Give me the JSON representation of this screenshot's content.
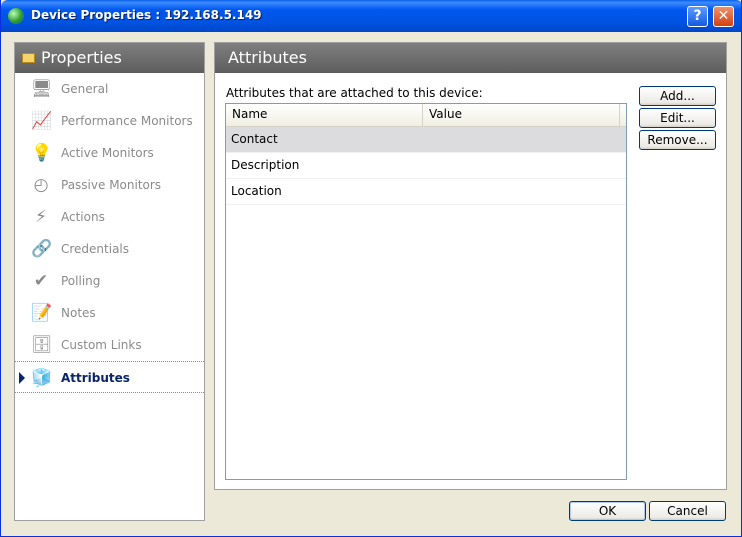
{
  "window": {
    "title": "Device Properties : 192.168.5.149",
    "help_glyph": "?",
    "close_glyph": "✕"
  },
  "sidebar": {
    "title": "Properties",
    "items": [
      {
        "label": "General",
        "icon": "computer-icon",
        "glyph": "🖥"
      },
      {
        "label": "Performance Monitors",
        "icon": "performance-chart-icon",
        "glyph": "📈"
      },
      {
        "label": "Active Monitors",
        "icon": "lightbulb-icon",
        "glyph": "💡"
      },
      {
        "label": "Passive Monitors",
        "icon": "gauge-icon",
        "glyph": "◴"
      },
      {
        "label": "Actions",
        "icon": "lightning-icon",
        "glyph": "⚡"
      },
      {
        "label": "Credentials",
        "icon": "network-credentials-icon",
        "glyph": "🔗"
      },
      {
        "label": "Polling",
        "icon": "checkmark-icon",
        "glyph": "✔"
      },
      {
        "label": "Notes",
        "icon": "notepad-icon",
        "glyph": "📝"
      },
      {
        "label": "Custom Links",
        "icon": "custom-links-icon",
        "glyph": "🗄"
      },
      {
        "label": "Attributes",
        "icon": "blocks-icon",
        "glyph": "🧊"
      }
    ],
    "active_index": 9
  },
  "main": {
    "title": "Attributes",
    "description": "Attributes that are attached to this device:",
    "columns": [
      "Name",
      "Value"
    ],
    "rows": [
      {
        "name": "Contact",
        "value": ""
      },
      {
        "name": "Description",
        "value": ""
      },
      {
        "name": "Location",
        "value": ""
      }
    ],
    "selected_row": 0,
    "buttons": {
      "add": "Add...",
      "edit": "Edit...",
      "remove": "Remove..."
    }
  },
  "footer": {
    "ok": "OK",
    "cancel": "Cancel"
  },
  "colors": {
    "titlebar": "#0054e3",
    "panel_header": "#6e6e6e",
    "dialog_bg": "#ece9d8",
    "active_item": "#0a246a"
  }
}
